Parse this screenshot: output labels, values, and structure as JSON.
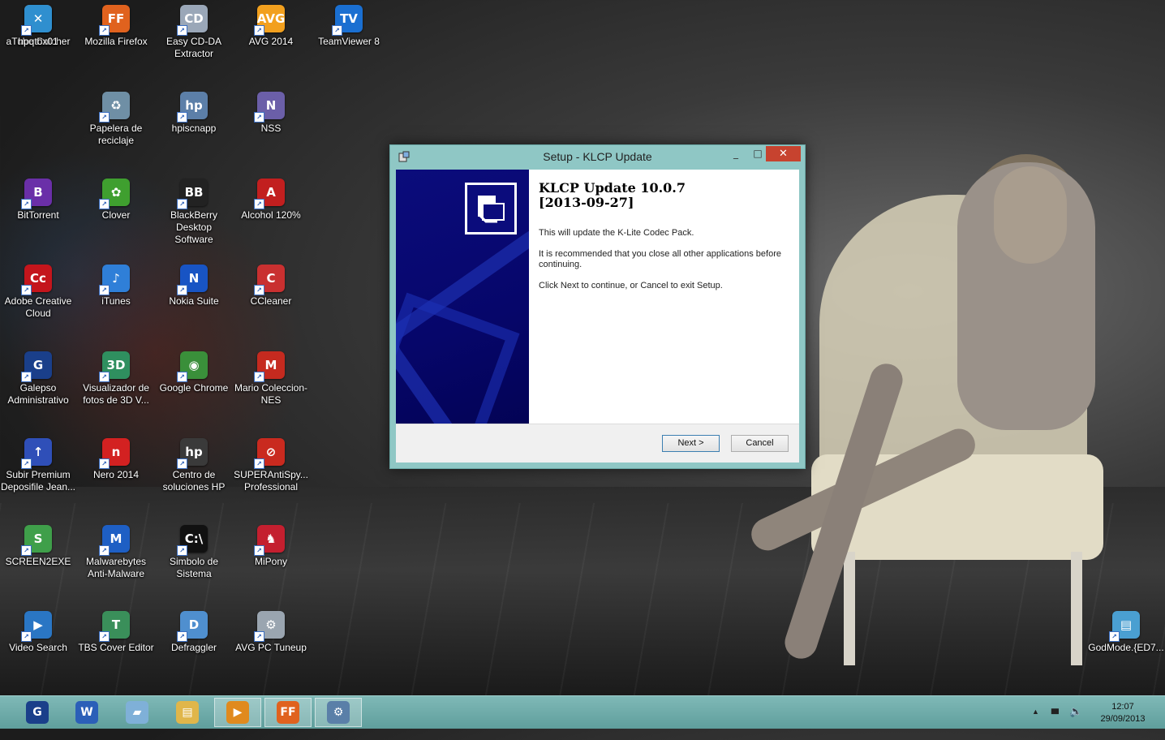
{
  "desktop": {
    "icons": [
      {
        "label": "aTube Catcher",
        "glyph": "~",
        "color": "#d4571b"
      },
      {
        "label": "Mozilla Firefox",
        "glyph": "FF",
        "color": "#e0621e"
      },
      {
        "label": "Easy CD-DA Extractor",
        "glyph": "CD",
        "color": "#9aa7b8"
      },
      {
        "label": "AVG 2014",
        "glyph": "AVG",
        "color": "#f2a01e"
      },
      {
        "label": "TeamViewer 8",
        "glyph": "TV",
        "color": "#1a6fd1"
      },
      {
        "label": "Papelera de reciclaje",
        "glyph": "♻",
        "color": "#6f8fa5"
      },
      {
        "label": "hpiscnapp",
        "glyph": "hp",
        "color": "#5c7fa8"
      },
      {
        "label": "NSS",
        "glyph": "N",
        "color": "#6b5fa8"
      },
      {
        "label": "BitTorrent",
        "glyph": "B",
        "color": "#6a2fa8"
      },
      {
        "label": "Clover",
        "glyph": "✿",
        "color": "#3f9f2f"
      },
      {
        "label": "BlackBerry Desktop Software",
        "glyph": "BB",
        "color": "#222222"
      },
      {
        "label": "Alcohol 120%",
        "glyph": "A",
        "color": "#c21f1f"
      },
      {
        "label": "Adobe Creative Cloud",
        "glyph": "Cc",
        "color": "#c4151c"
      },
      {
        "label": "iTunes",
        "glyph": "♪",
        "color": "#2f7fd8"
      },
      {
        "label": "Nokia Suite",
        "glyph": "N",
        "color": "#1854c4"
      },
      {
        "label": "CCleaner",
        "glyph": "C",
        "color": "#c93030"
      },
      {
        "label": "Galepso Administrativo",
        "glyph": "G",
        "color": "#1a3f8a"
      },
      {
        "label": "Visualizador de fotos de 3D V...",
        "glyph": "3D",
        "color": "#2f8f5f"
      },
      {
        "label": "Google Chrome",
        "glyph": "◉",
        "color": "#3a8f3a"
      },
      {
        "label": "Mario Coleccion-NES",
        "glyph": "M",
        "color": "#c52a1f"
      },
      {
        "label": "Subir Premium Deposifile Jean...",
        "glyph": "↑",
        "color": "#2f4fb8"
      },
      {
        "label": "Nero 2014",
        "glyph": "n",
        "color": "#d32121"
      },
      {
        "label": "Centro de soluciones HP",
        "glyph": "hp",
        "color": "#3a3a3a"
      },
      {
        "label": "SUPERAntiSpy... Professional",
        "glyph": "⊘",
        "color": "#c92a1f"
      },
      {
        "label": "SCREEN2EXE",
        "glyph": "S",
        "color": "#3f9f4a"
      },
      {
        "label": "Malwarebytes Anti-Malware",
        "glyph": "M",
        "color": "#1e5fc4"
      },
      {
        "label": "Simbolo de Sistema",
        "glyph": "C:\\",
        "color": "#111111"
      },
      {
        "label": "MiPony",
        "glyph": "♞",
        "color": "#c41f2f"
      },
      {
        "label": "Video Search",
        "glyph": "▶",
        "color": "#2a76c4"
      },
      {
        "label": "TBS Cover Editor",
        "glyph": "T",
        "color": "#3a8f5a"
      },
      {
        "label": "Defraggler",
        "glyph": "D",
        "color": "#4f8fcf"
      },
      {
        "label": "AVG PC Tuneup",
        "glyph": "⚙",
        "color": "#9aa5b0"
      },
      {
        "label": "hpqtbx01",
        "glyph": "✕",
        "color": "#2f8fcf"
      },
      {
        "label": "GodMode.{ED7...",
        "glyph": "▤",
        "color": "#4a9fd1"
      }
    ]
  },
  "window": {
    "title": "Setup - KLCP Update",
    "minimize": "_",
    "maximize": "□",
    "close": "✕",
    "heading_line1": "KLCP Update 10.0.7",
    "heading_line2": "[2013-09-27]",
    "para1": "This will update the K-Lite Codec Pack.",
    "para2": "It is recommended that you close all other applications before continuing.",
    "para3": "Click Next to continue, or Cancel to exit Setup.",
    "next_label": "Next >",
    "cancel_label": "Cancel"
  },
  "taskbar": {
    "items": [
      {
        "name": "galepso",
        "glyph": "G",
        "color": "#1a3f8a",
        "active": false
      },
      {
        "name": "word",
        "glyph": "W",
        "color": "#2b5fb8",
        "active": false
      },
      {
        "name": "notebook",
        "glyph": "▰",
        "color": "#7fb0d8",
        "active": false
      },
      {
        "name": "file-explorer",
        "glyph": "▤",
        "color": "#e0b64a",
        "active": false
      },
      {
        "name": "media-player",
        "glyph": "▶",
        "color": "#e08a1e",
        "active": true
      },
      {
        "name": "firefox",
        "glyph": "FF",
        "color": "#e0621e",
        "active": true
      },
      {
        "name": "setup",
        "glyph": "⚙",
        "color": "#5a7fa8",
        "active": true
      }
    ],
    "tray_icons": {
      "expand": "▲",
      "network": "▮▮▮",
      "volume": "🔈"
    },
    "time": "12:07",
    "date": "29/09/2013"
  }
}
